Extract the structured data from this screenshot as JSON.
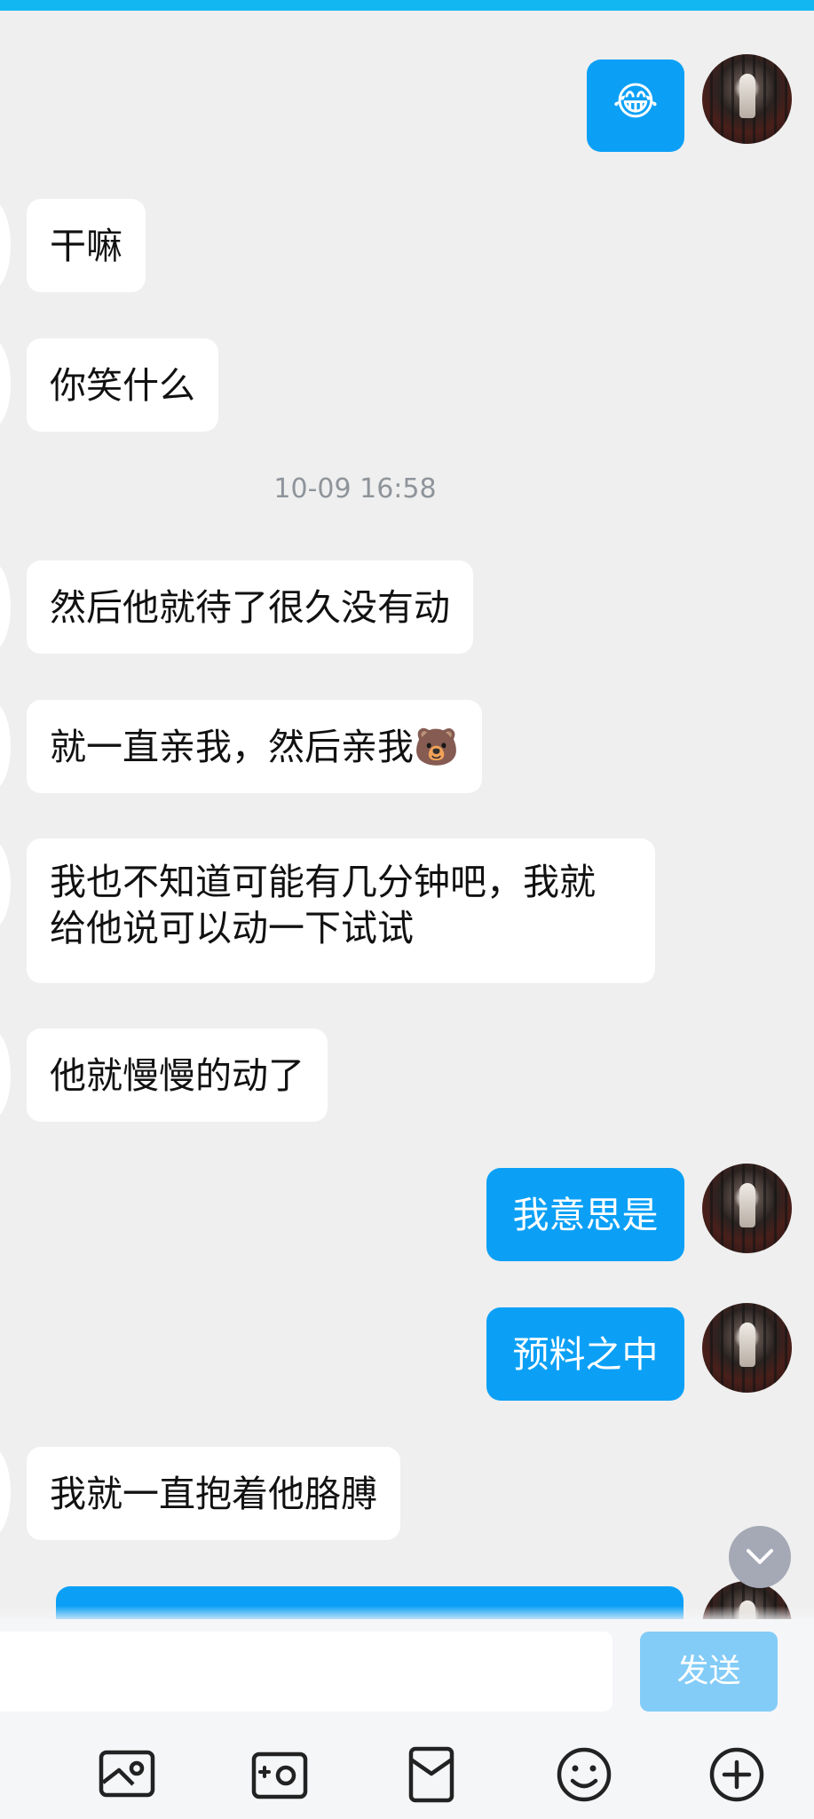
{
  "messages": [
    {
      "side": "right",
      "text": "😂"
    },
    {
      "side": "left",
      "text": "干嘛"
    },
    {
      "side": "left",
      "text": "你笑什么"
    },
    {
      "side": "time",
      "text": "10-09 16:58"
    },
    {
      "side": "left",
      "text": "然后他就待了很久没有动"
    },
    {
      "side": "left",
      "text": "就一直亲我，然后亲我🐻"
    },
    {
      "side": "left",
      "lines": [
        "我也不知道可能有几分钟吧，我就",
        "给他说可以动一下试试"
      ]
    },
    {
      "side": "left",
      "text": "他就慢慢的动了"
    },
    {
      "side": "right",
      "text": "我意思是"
    },
    {
      "side": "right",
      "text": "预料之中"
    },
    {
      "side": "left",
      "text": "我就一直抱着他胳膊"
    }
  ],
  "composer": {
    "input_value": "",
    "send_label": "发送"
  },
  "toolbar": {
    "icons": [
      "image-icon",
      "camera-icon",
      "red-packet-icon",
      "emoji-icon",
      "plus-icon"
    ]
  },
  "colors": {
    "outgoing_bubble": "#0ba0f6",
    "incoming_bubble": "#ffffff",
    "background": "#efefef",
    "send_button": "#83ccf7",
    "top_bar": "#12b6f0"
  }
}
